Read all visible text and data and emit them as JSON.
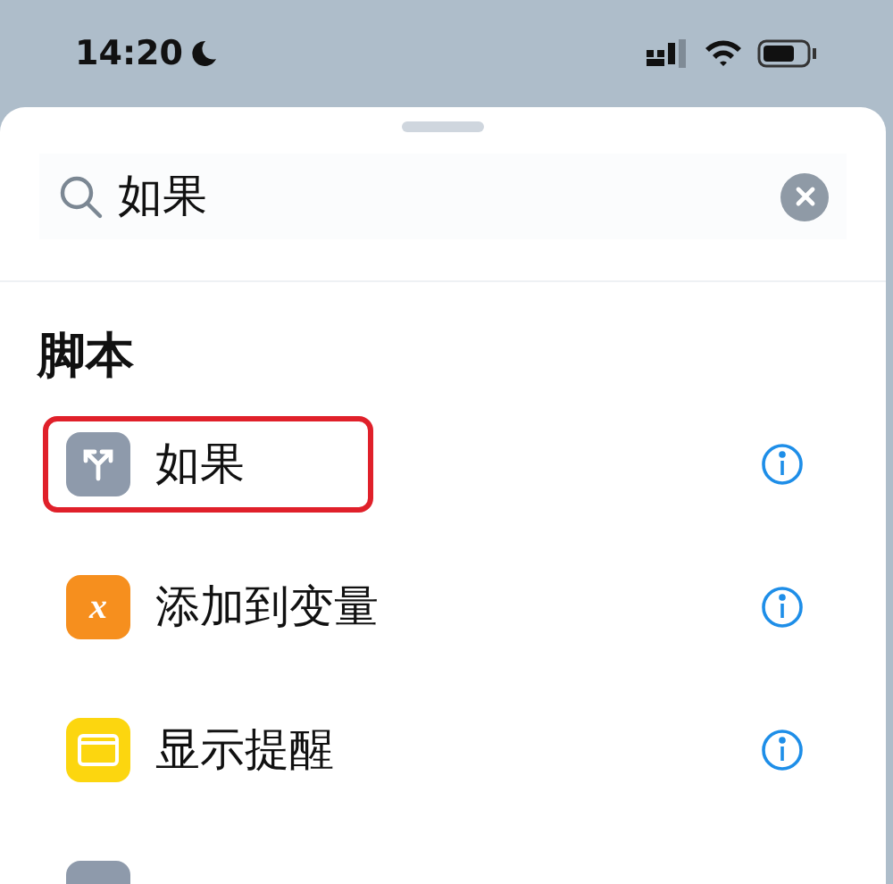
{
  "status_bar": {
    "time": "14:20"
  },
  "search": {
    "value": "如果"
  },
  "section": {
    "title": "脚本",
    "items": [
      {
        "kind": "branch",
        "label": "如果",
        "highlighted": true
      },
      {
        "kind": "variable",
        "label": "添加到变量",
        "icon_text": "x",
        "highlighted": false
      },
      {
        "kind": "alert",
        "label": "显示提醒",
        "highlighted": false
      },
      {
        "kind": "partial",
        "highlighted": false
      }
    ]
  }
}
